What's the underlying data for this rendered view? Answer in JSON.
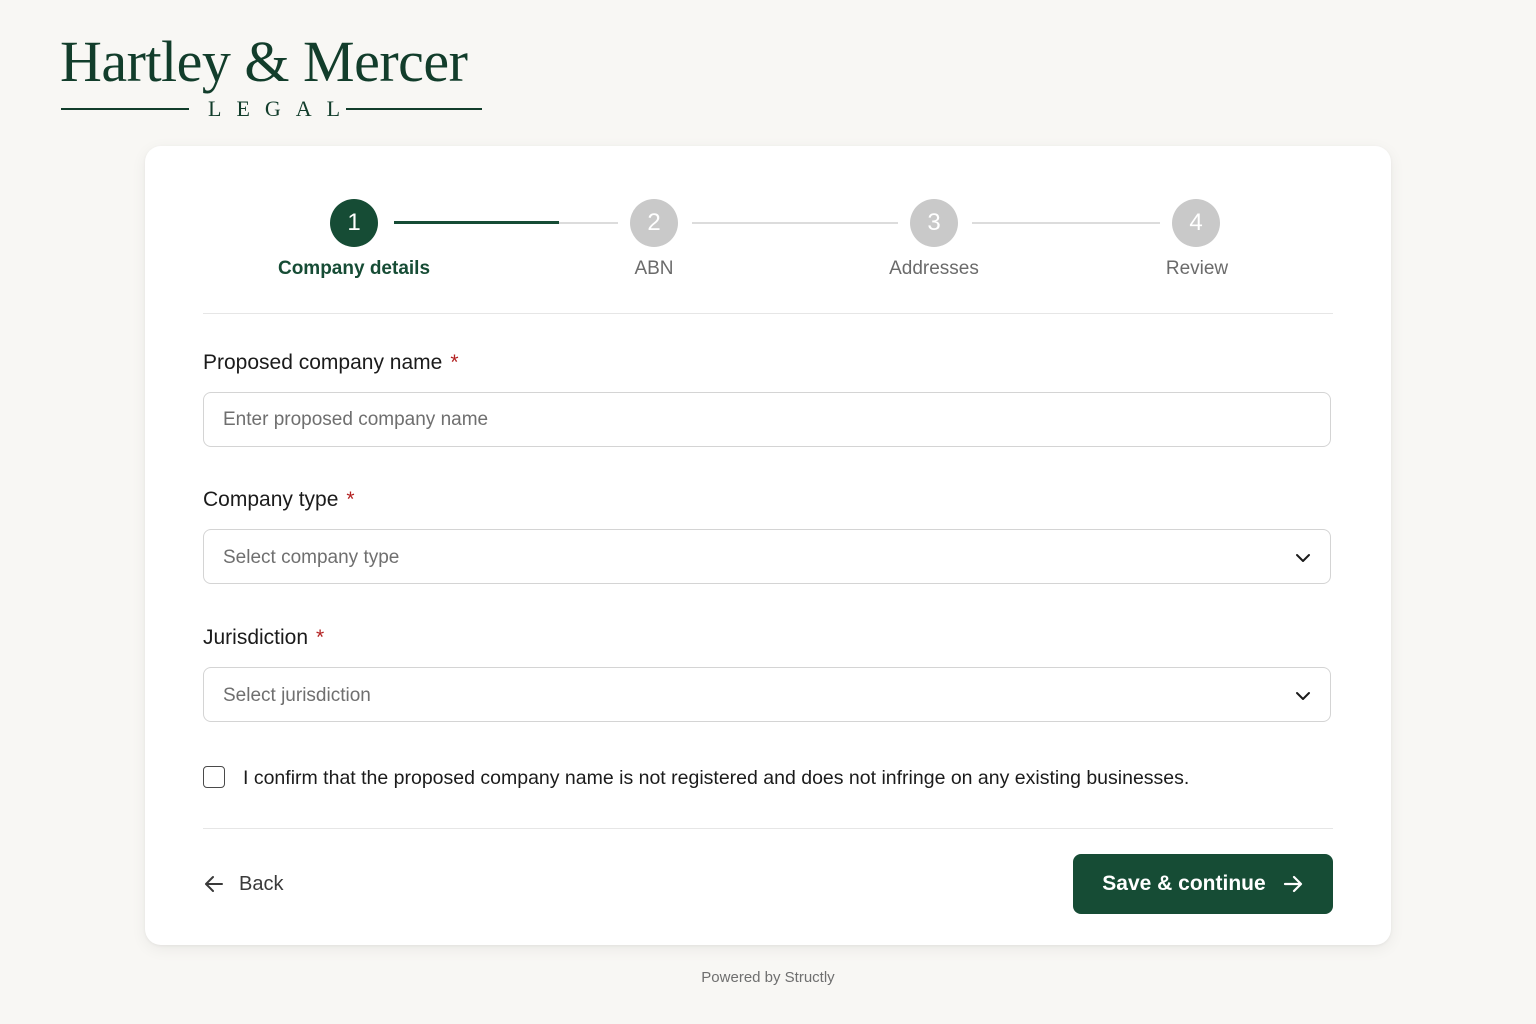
{
  "brand": {
    "name": "Hartley & Mercer",
    "subtitle": "LEGAL"
  },
  "stepper": {
    "steps": [
      {
        "number": "1",
        "label": "Company details",
        "state": "active"
      },
      {
        "number": "2",
        "label": "ABN",
        "state": "upcoming"
      },
      {
        "number": "3",
        "label": "Addresses",
        "state": "upcoming"
      },
      {
        "number": "4",
        "label": "Review",
        "state": "upcoming"
      }
    ]
  },
  "form": {
    "company_name": {
      "label": "Proposed company name",
      "required_mark": "*",
      "placeholder": "Enter proposed company name",
      "value": ""
    },
    "company_type": {
      "label": "Company type",
      "required_mark": "*",
      "placeholder": "Select company type"
    },
    "jurisdiction": {
      "label": "Jurisdiction",
      "required_mark": "*",
      "placeholder": "Select jurisdiction"
    },
    "confirm": {
      "label": "I confirm that the proposed company name is not registered and does not infringe on any existing businesses.",
      "checked": false
    }
  },
  "actions": {
    "back_label": "Back",
    "save_label": "Save & continue"
  },
  "footer": {
    "text": "Powered by Structly"
  },
  "colors": {
    "brand_green": "#164c35",
    "required_red": "#b32222",
    "inactive_step": "#c9c9c9"
  },
  "icons": {
    "back": "arrow-left-icon",
    "forward": "arrow-right-icon",
    "dropdown": "chevron-down-icon"
  }
}
